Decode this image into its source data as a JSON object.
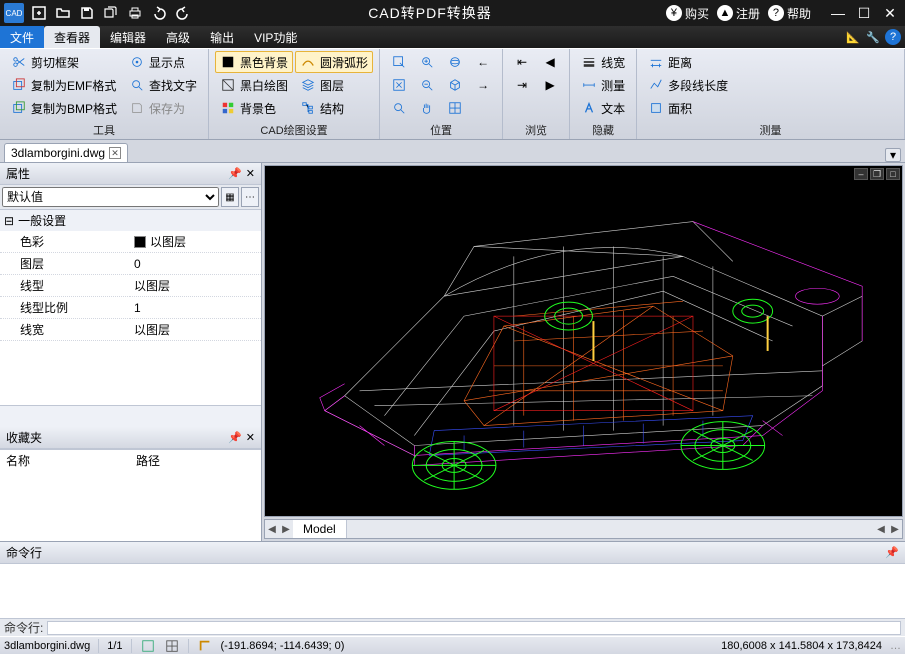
{
  "app": {
    "title": "CAD转PDF转换器"
  },
  "titlebar": {
    "buy": "购买",
    "register": "注册",
    "help": "帮助"
  },
  "menu": {
    "file": "文件",
    "viewer": "查看器",
    "editor": "编辑器",
    "advanced": "高级",
    "output": "输出",
    "vip": "VIP功能"
  },
  "ribbon": {
    "groups": {
      "tools": {
        "label": "工具",
        "items": {
          "cut_frame": "剪切框架",
          "copy_emf": "复制为EMF格式",
          "copy_bmp": "复制为BMP格式",
          "show_pts": "显示点",
          "find_text": "查找文字",
          "save_as": "保存为"
        }
      },
      "cad": {
        "label": "CAD绘图设置",
        "items": {
          "black_bg": "黑色背景",
          "mono": "黑白绘图",
          "bg_color": "背景色",
          "smooth_arc": "圆滑弧形",
          "layers": "图层",
          "struct": "结构"
        }
      },
      "position": {
        "label": "位置"
      },
      "browse": {
        "label": "浏览"
      },
      "hide": {
        "label": "隐藏",
        "items": {
          "linewidth": "线宽",
          "measure": "测量",
          "text": "文本"
        }
      },
      "measure": {
        "label": "测量",
        "items": {
          "distance": "距离",
          "polylen": "多段线长度",
          "area": "面积"
        }
      }
    }
  },
  "document": {
    "tab_name": "3dlamborgini.dwg"
  },
  "props": {
    "title": "属性",
    "selector": "默认值",
    "category": "一般设置",
    "rows": {
      "color": {
        "k": "色彩",
        "v": "以图层"
      },
      "layer": {
        "k": "图层",
        "v": "0"
      },
      "ltype": {
        "k": "线型",
        "v": "以图层"
      },
      "lscale": {
        "k": "线型比例",
        "v": "1"
      },
      "lw": {
        "k": "线宽",
        "v": "以图层"
      }
    }
  },
  "favorites": {
    "title": "收藏夹",
    "col_name": "名称",
    "col_path": "路径"
  },
  "viewport": {
    "tab_model": "Model"
  },
  "command": {
    "title": "命令行",
    "prompt": "命令行:"
  },
  "status": {
    "file": "3dlamborgini.dwg",
    "ratio": "1/1",
    "coords": "(-191.8694; -114.6439; 0)",
    "extents": "180,6008 x 141.5804 x 173,8424"
  }
}
